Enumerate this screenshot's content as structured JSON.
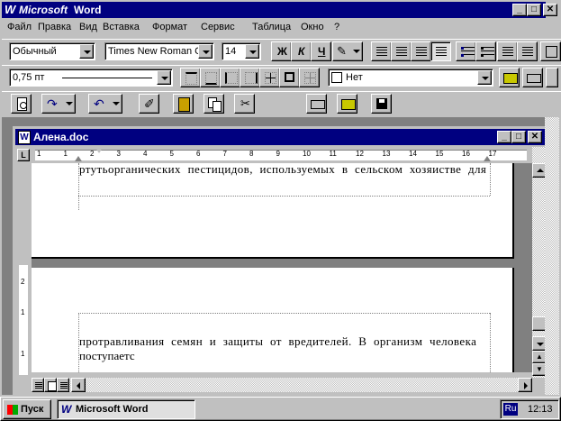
{
  "app": {
    "title_brand": "Microsoft",
    "title_name": "Word"
  },
  "menu": [
    {
      "label": "Файл"
    },
    {
      "label": "Правка"
    },
    {
      "label": "Вид"
    },
    {
      "label": "Вставка"
    },
    {
      "label": "Формат"
    },
    {
      "label": "Сервис"
    },
    {
      "label": "Таблица"
    },
    {
      "label": "Окно"
    },
    {
      "label": "?"
    }
  ],
  "format_bar": {
    "style": "Обычный",
    "font": "Times New Roman C",
    "size": "14",
    "bold": "Ж",
    "italic": "К",
    "underline": "Ч"
  },
  "border_bar": {
    "line_width": "0,75 пт",
    "shading": "Нет"
  },
  "document": {
    "title": "Алена.doc",
    "page1_line": "ртутьорганических пестицидов, используемых в сельском хозяистве для",
    "page2_line1": "протравливания семян и защиты от вредителей. В организм человека",
    "page2_line2": "поступаетс",
    "ruler_labels": [
      "1",
      "1",
      "2",
      "3",
      "4",
      "5",
      "6",
      "7",
      "8",
      "9",
      "10",
      "11",
      "12",
      "13",
      "14",
      "15",
      "16",
      "17"
    ],
    "vruler_labels": [
      "2",
      "1",
      "1"
    ]
  },
  "taskbar": {
    "start": "Пуск",
    "task": "Microsoft Word",
    "lang": "Ru",
    "clock": "12:13"
  }
}
